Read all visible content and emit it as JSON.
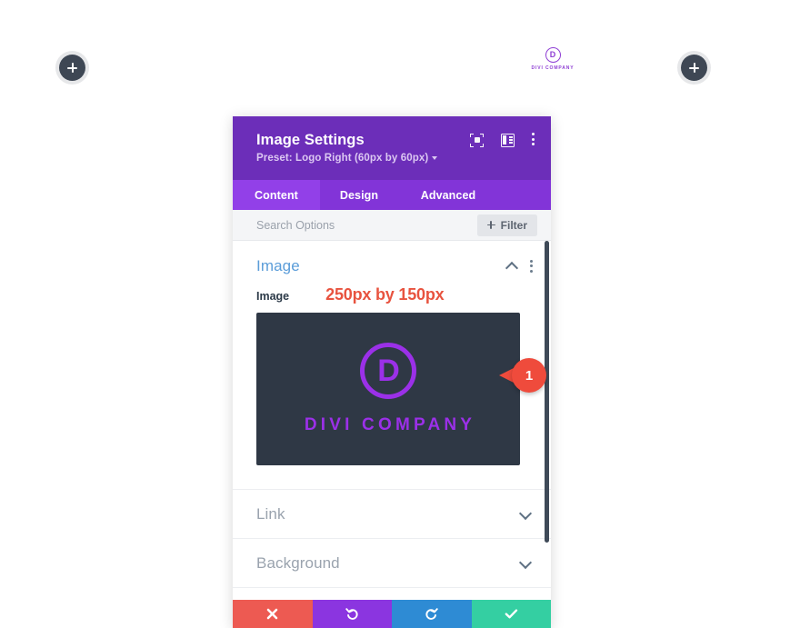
{
  "page": {
    "logo": {
      "mark_letter": "D",
      "wordmark": "DIVI COMPANY"
    },
    "add_left_label": "+",
    "add_right_label": "+"
  },
  "modal": {
    "title": "Image Settings",
    "preset": "Preset: Logo Right (60px by 60px)",
    "header_tools": [
      {
        "name": "expand-icon",
        "label": "Expand view"
      },
      {
        "name": "panel-layout-icon",
        "label": "Change panel layout"
      },
      {
        "name": "more-options-icon",
        "label": "More options"
      }
    ],
    "tabs": [
      {
        "label": "Content",
        "active": true
      },
      {
        "label": "Design",
        "active": false
      },
      {
        "label": "Advanced",
        "active": false
      }
    ],
    "search": {
      "placeholder": "Search Options",
      "value": ""
    },
    "filter_button": "Filter",
    "sections": [
      {
        "title": "Image",
        "expanded": true,
        "field_label": "Image",
        "annotation": "250px by 150px",
        "preview": {
          "mark_letter": "D",
          "wordmark": "DIVI COMPANY",
          "background": "#2f3845",
          "accent": "#9b30e8"
        },
        "callout": {
          "number": "1",
          "color": "#ef4b3c"
        }
      },
      {
        "title": "Link",
        "expanded": false
      },
      {
        "title": "Background",
        "expanded": false
      }
    ],
    "footer_buttons": [
      {
        "name": "discard-changes-button",
        "icon": "close-icon",
        "color": "#ed5a52"
      },
      {
        "name": "undo-button",
        "icon": "undo-icon",
        "color": "#8b35e0"
      },
      {
        "name": "redo-button",
        "icon": "redo-icon",
        "color": "#2e8bd4"
      },
      {
        "name": "save-changes-button",
        "icon": "checkmark-icon",
        "color": "#34cfa2"
      }
    ]
  },
  "colors": {
    "header_purple": "#6c2eb9",
    "tabs_purple": "#8234d8",
    "tab_active_purple": "#9240e8",
    "section_title_blue": "#5b9dd9",
    "annotation_red": "#e8533f",
    "divi_purple": "#9b30e8",
    "preview_dark": "#2f3845"
  }
}
